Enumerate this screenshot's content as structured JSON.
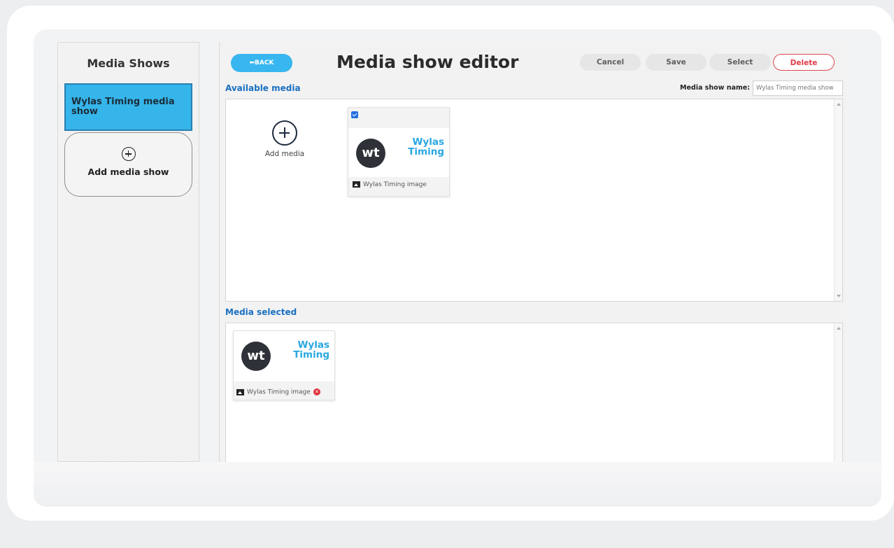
{
  "sidebar": {
    "title": "Media Shows",
    "items": [
      {
        "label": "Wylas Timing media show"
      }
    ],
    "add_label": "Add media show"
  },
  "header": {
    "back_label": "⬅BACK",
    "title": "Media show editor",
    "buttons": {
      "cancel": "Cancel",
      "save": "Save",
      "select": "Select",
      "delete": "Delete"
    }
  },
  "available": {
    "label": "Available media",
    "name_label": "Media show name:",
    "name_value": "Wylas Timing media show",
    "add_media_label": "Add media",
    "items": [
      {
        "checked": true,
        "logo_initials": "wt",
        "logo_line1": "Wylas",
        "logo_line2": "Timing",
        "caption": "Wylas Timing image"
      }
    ]
  },
  "selected": {
    "label": "Media selected",
    "items": [
      {
        "logo_initials": "wt",
        "logo_line1": "Wylas",
        "logo_line2": "Timing",
        "caption": "Wylas Timing image"
      }
    ]
  },
  "colors": {
    "accent": "#38b6ef",
    "selected_item": "#35b5ea",
    "section_label": "#1a6fc0",
    "delete": "#e03a45"
  }
}
